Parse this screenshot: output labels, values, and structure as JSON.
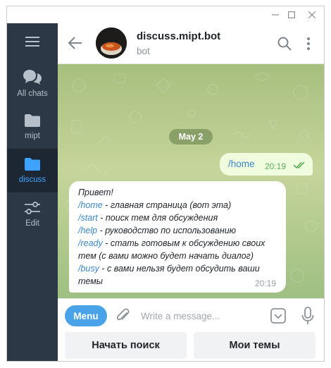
{
  "sidebar": {
    "items": [
      {
        "label": "All chats",
        "icon": "chat-bubbles-icon"
      },
      {
        "label": "mipt",
        "icon": "folder-icon"
      },
      {
        "label": "discuss",
        "icon": "folder-icon",
        "active": true
      },
      {
        "label": "Edit",
        "icon": "sliders-icon"
      }
    ]
  },
  "header": {
    "title": "discuss.mipt.bot",
    "subtitle": "bot"
  },
  "messages": {
    "date": "May 2",
    "outgoing": {
      "text": "/home",
      "time": "20:19"
    },
    "incoming": {
      "lines": [
        [
          {
            "t": "Привет!",
            "cmd": false
          }
        ],
        [
          {
            "t": "/home",
            "cmd": true
          },
          {
            "t": " - главная страница (вот эта)",
            "cmd": false
          }
        ],
        [
          {
            "t": "/start",
            "cmd": true
          },
          {
            "t": " - поиск тем для обсуждения",
            "cmd": false
          }
        ],
        [
          {
            "t": "/help",
            "cmd": true
          },
          {
            "t": " - руководство по использованию",
            "cmd": false
          }
        ],
        [
          {
            "t": "/ready",
            "cmd": true
          },
          {
            "t": " - стать готовым к обсуждению своих",
            "cmd": false
          }
        ],
        [
          {
            "t": "тем (с вами можно будет начать диалог)",
            "cmd": false
          }
        ],
        [
          {
            "t": "/busy",
            "cmd": true
          },
          {
            "t": " - с вами нельзя будет обсудить ваши",
            "cmd": false
          }
        ],
        [
          {
            "t": "темы",
            "cmd": false
          }
        ]
      ],
      "time": "20:19"
    }
  },
  "input": {
    "menu_label": "Menu",
    "placeholder": "Write a message..."
  },
  "keyboard": {
    "buttons": [
      "Начать поиск",
      "Мои темы"
    ]
  },
  "colors": {
    "accent": "#4aa3e8",
    "sidebar_bg": "#2c3845",
    "sidebar_active": "#3ea3ff",
    "outgoing_bubble": "#effdde",
    "command_link": "#3a86c8"
  }
}
